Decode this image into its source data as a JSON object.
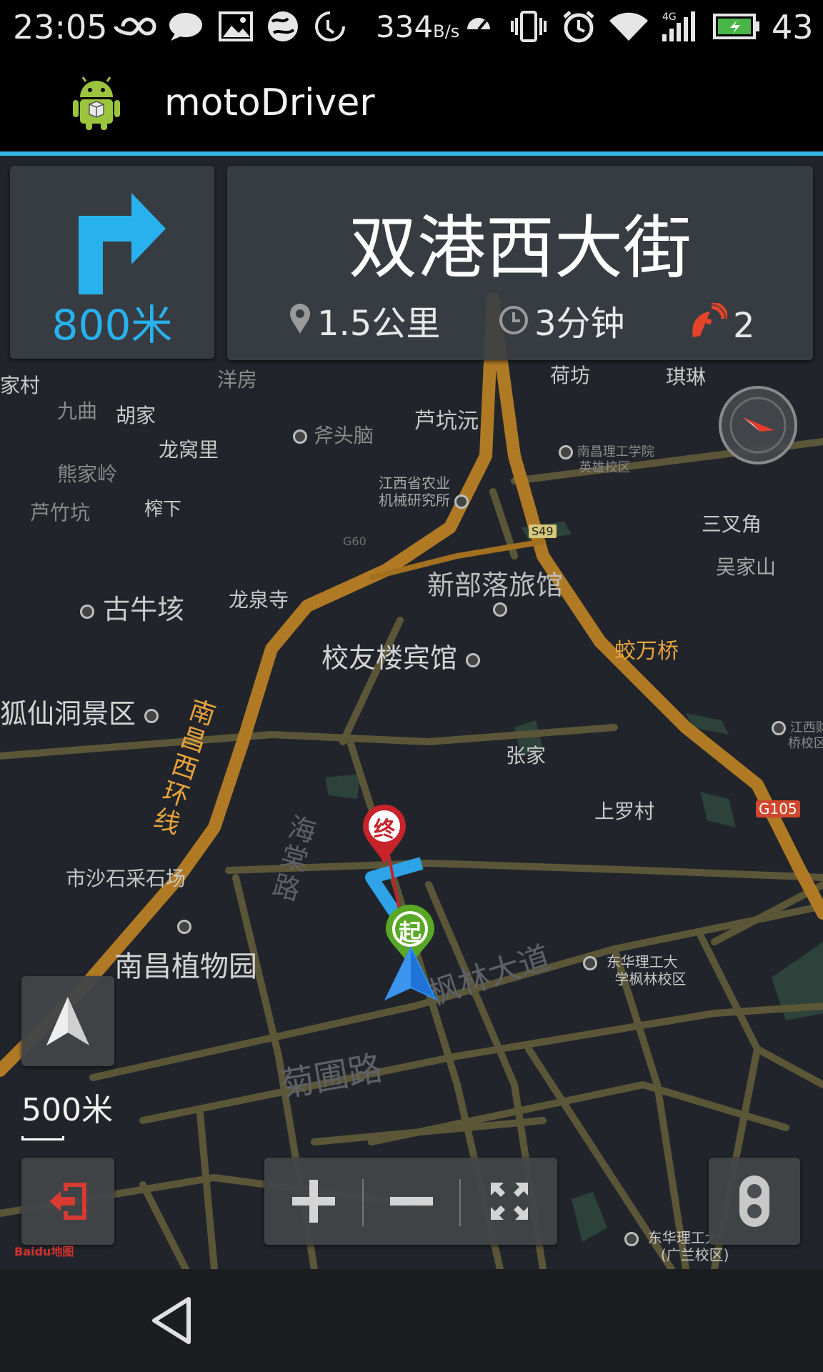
{
  "status_bar": {
    "time": "23:05",
    "network_speed": "334",
    "network_speed_unit": "B/s",
    "battery_percent": "43",
    "icons": [
      "infinity-icon",
      "chat-icon",
      "image-icon",
      "globe-icon",
      "sync-icon",
      "speed-icon",
      "vibrate-icon",
      "alarm-icon",
      "wifi-icon",
      "signal-4g-icon",
      "battery-icon"
    ]
  },
  "app": {
    "title": "motoDriver"
  },
  "navigation": {
    "turn_distance": "800米",
    "road_name": "双港西大街",
    "remaining_distance": "1.5公里",
    "remaining_time": "3分钟",
    "satellites": "2"
  },
  "map": {
    "scale": "500米",
    "start_marker": "起",
    "end_marker": "终",
    "baidu_logo": "Baidu地图",
    "labels": [
      {
        "text": "家村"
      },
      {
        "text": "洋房"
      },
      {
        "text": "荷坊"
      },
      {
        "text": "琪琳"
      },
      {
        "text": "九曲"
      },
      {
        "text": "胡家"
      },
      {
        "text": "芦坑沅"
      },
      {
        "text": "斧头脑"
      },
      {
        "text": "龙窝里"
      },
      {
        "text": "熊家岭"
      },
      {
        "text": "江西省农业"
      },
      {
        "text": "机械研究所"
      },
      {
        "text": "南昌理工学院"
      },
      {
        "text": "英雄校区"
      },
      {
        "text": "芦竹坑"
      },
      {
        "text": "榨下"
      },
      {
        "text": "三叉角"
      },
      {
        "text": "吴家山"
      },
      {
        "text": "S49"
      },
      {
        "text": "G60"
      },
      {
        "text": "新部落旅馆"
      },
      {
        "text": "古牛垓"
      },
      {
        "text": "龙泉寺"
      },
      {
        "text": "校友楼宾馆"
      },
      {
        "text": "蛟万桥"
      },
      {
        "text": "狐仙洞景区"
      },
      {
        "text": "南昌西环线"
      },
      {
        "text": "张家"
      },
      {
        "text": "江西财"
      },
      {
        "text": "桥校区"
      },
      {
        "text": "上罗村"
      },
      {
        "text": "G105"
      },
      {
        "text": "市沙石采石场"
      },
      {
        "text": "南昌植物园"
      },
      {
        "text": "东华理工大"
      },
      {
        "text": "学枫林校区"
      },
      {
        "text": "枫林大道"
      },
      {
        "text": "菊圃路"
      },
      {
        "text": "海棠路"
      },
      {
        "text": "东华理工大"
      },
      {
        "text": "(广兰校区)"
      }
    ]
  },
  "controls": {
    "zoom_in": "+",
    "zoom_out": "−"
  },
  "colors": {
    "accent": "#35b6e5",
    "turn_arrow": "#27b2ee",
    "road_major": "#b07a25",
    "road_minor": "#5f5a3e",
    "exit_red": "#d73a31"
  }
}
